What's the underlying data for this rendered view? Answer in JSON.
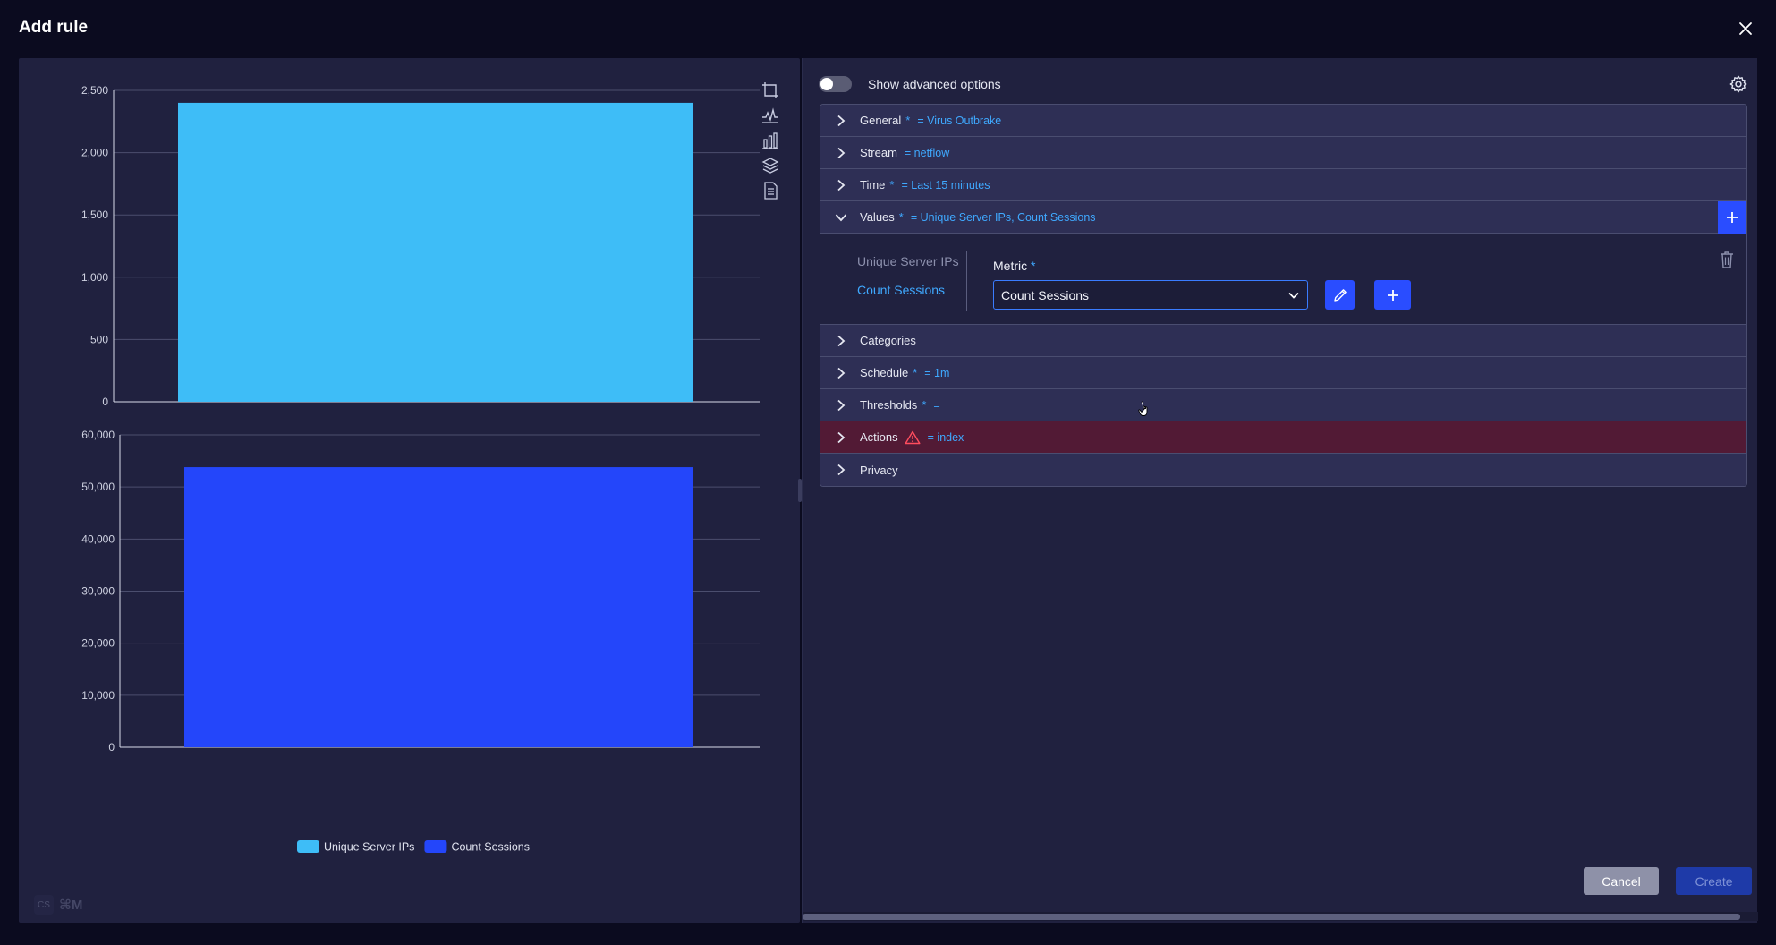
{
  "modal": {
    "title": "Add rule"
  },
  "chart_data": [
    {
      "type": "bar",
      "categories": [
        ""
      ],
      "series": [
        {
          "name": "Unique Server IPs",
          "values": [
            2400
          ]
        }
      ],
      "ylim": [
        0,
        2500
      ],
      "yticks": [
        "0",
        "500",
        "1,000",
        "1,500",
        "2,000",
        "2,500"
      ],
      "color": "#3ebdf7"
    },
    {
      "type": "bar",
      "categories": [
        ""
      ],
      "series": [
        {
          "name": "Count Sessions",
          "values": [
            53800
          ]
        }
      ],
      "ylim": [
        0,
        60000
      ],
      "yticks": [
        "0",
        "10,000",
        "20,000",
        "30,000",
        "40,000",
        "50,000",
        "60,000"
      ],
      "color": "#2446fa"
    }
  ],
  "legend": [
    {
      "label": "Unique Server IPs",
      "color": "#3ebdf7"
    },
    {
      "label": "Count Sessions",
      "color": "#2446fa"
    }
  ],
  "shortcut": {
    "key": "⌘M"
  },
  "settings": {
    "advanced_label": "Show advanced options",
    "advanced_on": false
  },
  "sections": [
    {
      "title": "General",
      "required": true,
      "value": "= Virus Outbrake"
    },
    {
      "title": "Stream",
      "required": false,
      "value": "= netflow"
    },
    {
      "title": "Time",
      "required": true,
      "value": "= Last 15 minutes"
    },
    {
      "title": "Values",
      "required": true,
      "value": "= Unique Server IPs, Count Sessions"
    },
    {
      "title": "Categories",
      "required": false,
      "value": ""
    },
    {
      "title": "Schedule",
      "required": true,
      "value": "= 1m"
    },
    {
      "title": "Thresholds",
      "required": true,
      "value": "="
    },
    {
      "title": "Actions",
      "required": false,
      "value": "= index"
    },
    {
      "title": "Privacy",
      "required": false,
      "value": ""
    }
  ],
  "values_panel": {
    "items": [
      "Unique Server IPs",
      "Count Sessions"
    ],
    "metric_label": "Metric",
    "metric_required": "*",
    "metric_selected": "Count Sessions"
  },
  "footer": {
    "cancel": "Cancel",
    "create": "Create"
  },
  "colors": {
    "accent": "#2a4dff",
    "link": "#3fa9ff",
    "error_row": "#521a35"
  }
}
